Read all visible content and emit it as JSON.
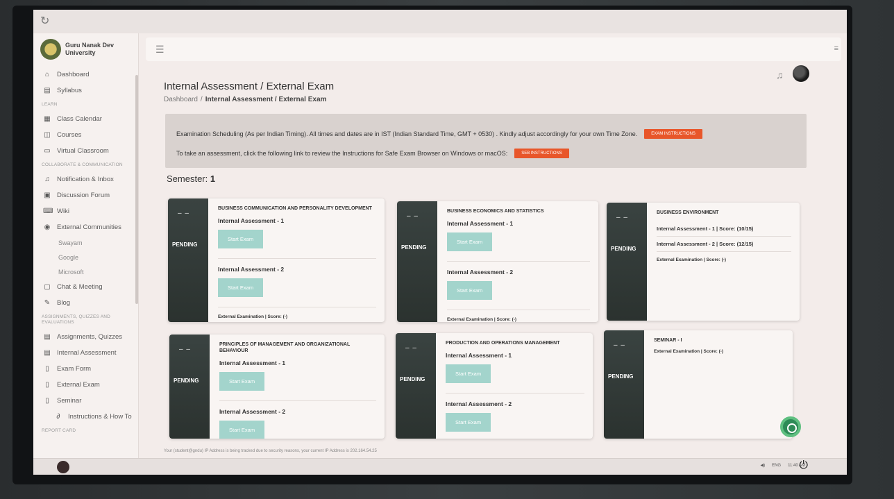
{
  "brand": {
    "name": "Guru Nanak Dev University"
  },
  "sidebar": {
    "top_items": [
      {
        "label": "Dashboard",
        "icon": "home-icon"
      },
      {
        "label": "Syllabus",
        "icon": "document-icon"
      }
    ],
    "learn_head": "LEARN",
    "learn_items": [
      {
        "label": "Class Calendar",
        "icon": "calendar-icon"
      },
      {
        "label": "Courses",
        "icon": "book-icon"
      },
      {
        "label": "Virtual Classroom",
        "icon": "monitor-icon"
      }
    ],
    "collab_head": "COLLABORATE & COMMUNICATION",
    "collab_items": [
      {
        "label": "Notification & Inbox",
        "icon": "bell-icon"
      },
      {
        "label": "Discussion Forum",
        "icon": "forum-icon"
      },
      {
        "label": "Wiki",
        "icon": "wiki-icon"
      },
      {
        "label": "External Communities",
        "icon": "globe-icon"
      }
    ],
    "community_subs": [
      "Swayam",
      "Google",
      "Microsoft"
    ],
    "collab_items2": [
      {
        "label": "Chat & Meeting",
        "icon": "chat-icon"
      },
      {
        "label": "Blog",
        "icon": "blog-icon"
      }
    ],
    "assign_head": "ASSIGNMENTS, QUIZZES AND EVALUATIONS",
    "assign_items": [
      {
        "label": "Assignments, Quizzes",
        "icon": "file-icon"
      },
      {
        "label": "Internal Assessment",
        "icon": "file-icon"
      },
      {
        "label": "Exam Form",
        "icon": "file-outline-icon"
      },
      {
        "label": "External Exam",
        "icon": "file-outline-icon"
      },
      {
        "label": "Seminar",
        "icon": "file-outline-icon"
      },
      {
        "label": "Instructions & How To",
        "icon": "link-icon"
      }
    ],
    "report_head": "REPORT CARD"
  },
  "page": {
    "title": "Internal Assessment / External Exam",
    "breadcrumb_root": "Dashboard",
    "breadcrumb_sep": "/",
    "breadcrumb_current": "Internal Assessment / External Exam"
  },
  "notice": {
    "line1": "Examination Scheduling (As per Indian Timing). All times and dates are in IST (Indian Standard Time, GMT + 0530) . Kindly adjust accordingly for your own Time Zone.",
    "btn1": "EXAM INSTRUCTIONS",
    "line2": "To take an assessment, click the following link to review the Instructions for Safe Exam Browser on Windows or macOS:",
    "btn2": "SEB INSTRUCTIONS",
    "accent": "#e8562a"
  },
  "semester": {
    "label": "Semester:",
    "value": "1"
  },
  "status": {
    "dash": "– –",
    "pending": "PENDING"
  },
  "labels": {
    "ia1": "Internal Assessment - 1",
    "ia2": "Internal Assessment - 2",
    "start": "Start Exam",
    "ext": "External Examination | Score: (-)"
  },
  "cards": [
    {
      "title": "BUSINESS COMMUNICATION AND PERSONALITY DEVELOPMENT"
    },
    {
      "title": "BUSINESS ECONOMICS AND STATISTICS"
    },
    {
      "title": "BUSINESS ENVIRONMENT",
      "score1": "Internal Assessment - 1 |  Score: (10/15)",
      "score2": "Internal Assessment - 2 |  Score: (12/15)"
    },
    {
      "title": "PRINCIPLES OF MANAGEMENT AND ORGANIZATIONAL BEHAVIOUR"
    },
    {
      "title": "PRODUCTION AND OPERATIONS MANAGEMENT"
    },
    {
      "title": "SEMINAR - I"
    }
  ],
  "footer": {
    "text": "Your (student@gndu) IP Address is being tracked due to security reasons, your current IP Address is 202.164.54.25"
  },
  "taskbar": {
    "lang": "ENG",
    "time": "11:40 AM"
  },
  "colors": {
    "start_button": "#a3d4cc",
    "status_panel": "#2f3735"
  }
}
